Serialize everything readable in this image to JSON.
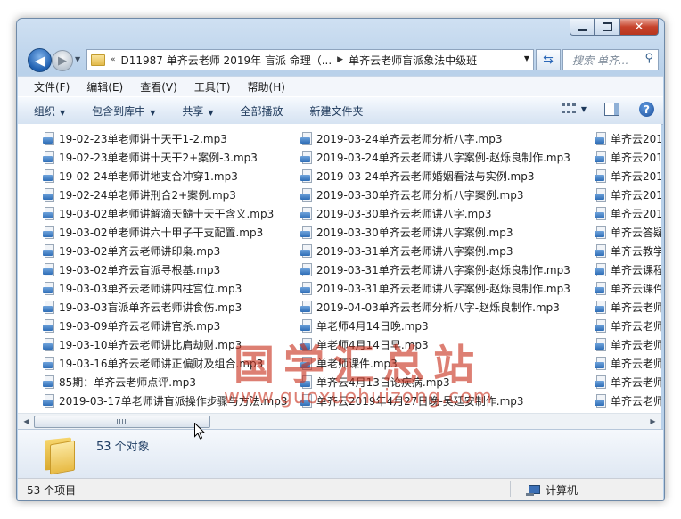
{
  "window": {
    "title": ""
  },
  "address": {
    "overflow": "«",
    "path1": "D11987 单齐云老师 2019年 盲派 命理（...",
    "path2": "单齐云老师盲派象法中级班"
  },
  "search": {
    "placeholder": "搜索 单齐..."
  },
  "menu": [
    "文件(F)",
    "编辑(E)",
    "查看(V)",
    "工具(T)",
    "帮助(H)"
  ],
  "toolbar": {
    "organize": "组织",
    "include": "包含到库中",
    "share": "共享",
    "play_all": "全部播放",
    "new_folder": "新建文件夹"
  },
  "files": {
    "col1": [
      "19-02-23单老师讲十天干1-2.mp3",
      "19-02-23单老师讲十天干2+案例-3.mp3",
      "19-02-24单老师讲地支合冲穿1.mp3",
      "19-02-24单老师讲刑合2+案例.mp3",
      "19-03-02单老师讲解滴天髓十天干含义.mp3",
      "19-03-02单老师讲六十甲子干支配置.mp3",
      "19-03-02单齐云老师讲印枭.mp3",
      "19-03-02单齐云盲派寻根基.mp3",
      "19-03-03单齐云老师讲四柱宫位.mp3",
      "19-03-03盲派单齐云老师讲食伤.mp3",
      "19-03-09单齐云老师讲官杀.mp3",
      "19-03-10单齐云老师讲比肩劫财.mp3",
      "19-03-16单齐云老师讲正偏财及组合.mp3",
      "85期：单齐云老师点评.mp3",
      "2019-03-17单老师讲盲派操作步骤与方法.mp3"
    ],
    "col2": [
      "2019-03-24单齐云老师分析八字.mp3",
      "2019-03-24单齐云老师讲八字案例-赵烁良制作.mp3",
      "2019-03-24单齐云老师婚姻看法与实例.mp3",
      "2019-03-30单齐云老师分析八字案例.mp3",
      "2019-03-30单齐云老师讲八字.mp3",
      "2019-03-30单齐云老师讲八字案例.mp3",
      "2019-03-31单齐云老师讲八字案例.mp3",
      "2019-03-31单齐云老师讲八字案例-赵烁良制作.mp3",
      "2019-03-31单齐云老师讲八字案例-赵烁良制作.mp3",
      "2019-04-03单齐云老师分析八字-赵烁良制作.mp3",
      "单老师4月14日晚.mp3",
      "单老师4月14日早.mp3",
      "单老师课件.mp3",
      "单齐云4月13日论疾病.mp3",
      "单齐云2019年4月27日晚-吴廷安制作.mp3"
    ],
    "col3": [
      "单齐云201",
      "单齐云201",
      "单齐云201",
      "单齐云201",
      "单齐云201",
      "单齐云答疑",
      "单齐云教学",
      "单齐云课程",
      "单齐云课件",
      "单齐云老师",
      "单齐云老师",
      "单齐云老师",
      "单齐云老师",
      "单齐云老师",
      "单齐云老师"
    ]
  },
  "watermark": {
    "title": "国学汇总站",
    "url": "www.guoxuehuizong.com"
  },
  "details": {
    "count_text": "53 个对象"
  },
  "status": {
    "items": "53 个项目",
    "location": "计算机"
  }
}
